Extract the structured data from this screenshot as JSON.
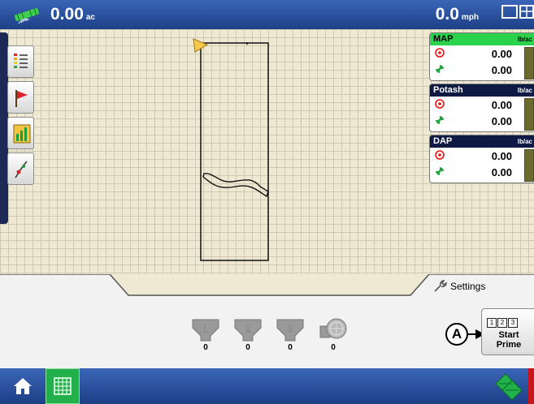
{
  "topbar": {
    "area_value": "0.00",
    "area_unit": "ac",
    "speed_value": "0.0",
    "speed_unit": "mph"
  },
  "tools": [
    {
      "name": "legend-icon"
    },
    {
      "name": "flag-icon"
    },
    {
      "name": "chart-icon"
    },
    {
      "name": "guidance-icon"
    }
  ],
  "products": [
    {
      "name": "MAP",
      "unit": "lb/ac",
      "target": "0.00",
      "actual": "0.00",
      "active": true
    },
    {
      "name": "Potash",
      "unit": "lb/ac",
      "target": "0.00",
      "actual": "0.00",
      "active": false
    },
    {
      "name": "DAP",
      "unit": "lb/ac",
      "target": "0.00",
      "actual": "0.00",
      "active": false
    }
  ],
  "settings_label": "Settings",
  "bins": [
    {
      "label": "1",
      "count": "0"
    },
    {
      "label": "2",
      "count": "0"
    },
    {
      "label": "3",
      "count": "0"
    },
    {
      "label": "",
      "count": "0"
    }
  ],
  "prime": {
    "nums": [
      "1",
      "2",
      "3"
    ],
    "line1": "Start",
    "line2": "Prime"
  },
  "callout_label": "A",
  "colors": {
    "bar_blue": "#1d3f86",
    "active_green": "#2bd24b",
    "header_navy": "#0f1a44",
    "map_bg": "#efe9d3"
  }
}
